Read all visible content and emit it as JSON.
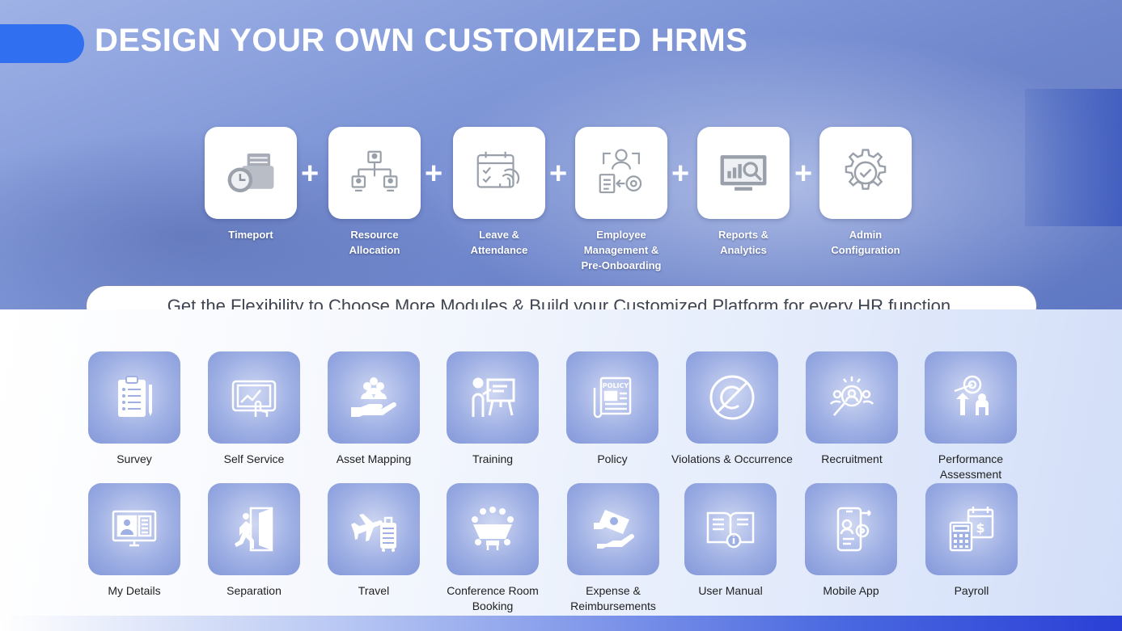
{
  "title": "DESIGN YOUR OWN CUSTOMIZED HRMS",
  "plus_sign": "+",
  "core_modules": [
    {
      "label": "Timeport",
      "icon": "timeport-icon"
    },
    {
      "label": "Resource Allocation",
      "icon": "org-chart-icon"
    },
    {
      "label": "Leave & Attendance",
      "icon": "calendar-fingerprint-icon"
    },
    {
      "label": "Employee Management & Pre-Onboarding",
      "icon": "employee-management-icon"
    },
    {
      "label": "Reports & Analytics",
      "icon": "reports-monitor-icon"
    },
    {
      "label": "Admin Configuration",
      "icon": "gear-check-icon"
    }
  ],
  "banner_text": "Get the Flexibility to Choose More Modules & Build your Customized Platform for every HR function.",
  "modules_row1": [
    {
      "label": "Survey",
      "icon": "clipboard-icon"
    },
    {
      "label": "Self Service",
      "icon": "tablet-touch-icon"
    },
    {
      "label": "Asset Mapping",
      "icon": "hand-people-icon"
    },
    {
      "label": "Training",
      "icon": "presentation-board-icon"
    },
    {
      "label": "Policy",
      "icon": "policy-document-icon"
    },
    {
      "label": "Violations & Occurrence",
      "icon": "prohibited-icon"
    },
    {
      "label": "Recruitment",
      "icon": "magnifier-people-icon"
    },
    {
      "label": "Performance Assessment",
      "icon": "target-growth-icon"
    }
  ],
  "modules_row2": [
    {
      "label": "My Details",
      "icon": "monitor-profile-icon"
    },
    {
      "label": "Separation",
      "icon": "exit-door-icon"
    },
    {
      "label": "Travel",
      "icon": "plane-luggage-icon"
    },
    {
      "label": "Conference Room Booking",
      "icon": "conference-table-icon"
    },
    {
      "label": "Expense & Reimbursements",
      "icon": "money-hand-icon"
    },
    {
      "label": "User Manual",
      "icon": "book-info-icon"
    },
    {
      "label": "Mobile App",
      "icon": "mobile-gear-icon"
    },
    {
      "label": "Payroll",
      "icon": "calculator-calendar-icon"
    }
  ],
  "colors": {
    "accent": "#2f6ff0",
    "tile": "#9fb0e4",
    "hero": "#8198d8"
  }
}
